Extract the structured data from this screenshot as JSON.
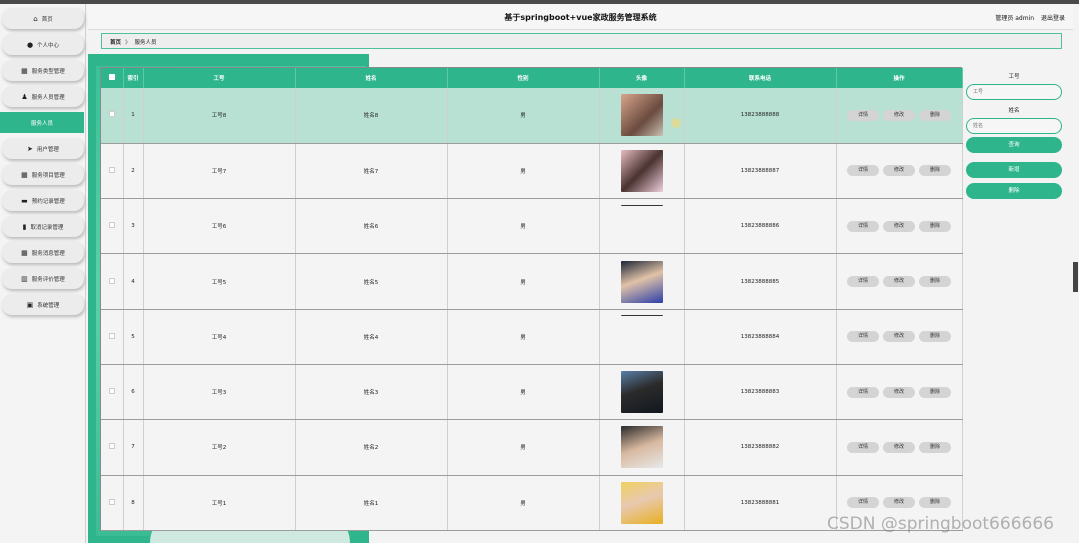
{
  "header": {
    "title": "基于springboot+vue家政服务管理系统",
    "user_label": "管理员 admin",
    "logout_label": "退出登录"
  },
  "sidebar": {
    "items": [
      {
        "label": "首页",
        "icon": "home-icon"
      },
      {
        "label": "个人中心",
        "icon": "user-icon"
      },
      {
        "label": "服务类型管理",
        "icon": "grid-icon"
      },
      {
        "label": "服务人员管理",
        "icon": "person-icon"
      },
      {
        "label": "服务人员",
        "icon": "",
        "active": true
      },
      {
        "label": "用户管理",
        "icon": "send-icon"
      },
      {
        "label": "服务项目管理",
        "icon": "grid-icon"
      },
      {
        "label": "预约记录管理",
        "icon": "ticket-icon"
      },
      {
        "label": "取消记录管理",
        "icon": "book-icon"
      },
      {
        "label": "服务消息管理",
        "icon": "grid-icon"
      },
      {
        "label": "服务评价管理",
        "icon": "bar-chart-icon"
      },
      {
        "label": "系统管理",
        "icon": "briefcase-icon"
      }
    ]
  },
  "breadcrumb": {
    "home": "首页",
    "separator": "》",
    "current": "服务人员"
  },
  "table": {
    "columns": [
      "索引",
      "工号",
      "姓名",
      "性别",
      "头像",
      "联系电话",
      "操作"
    ],
    "rows": [
      {
        "index": "1",
        "code": "工号8",
        "name": "姓名8",
        "gender": "男",
        "phone": "13823888888",
        "avatar": "photo",
        "highlight": true
      },
      {
        "index": "2",
        "code": "工号7",
        "name": "姓名7",
        "gender": "男",
        "phone": "13823888887",
        "avatar": "photo"
      },
      {
        "index": "3",
        "code": "工号6",
        "name": "姓名6",
        "gender": "男",
        "phone": "13823888886",
        "avatar": "broken"
      },
      {
        "index": "4",
        "code": "工号5",
        "name": "姓名5",
        "gender": "男",
        "phone": "13823888885",
        "avatar": "photo"
      },
      {
        "index": "5",
        "code": "工号4",
        "name": "姓名4",
        "gender": "男",
        "phone": "13823888884",
        "avatar": "broken"
      },
      {
        "index": "6",
        "code": "工号3",
        "name": "姓名3",
        "gender": "男",
        "phone": "13823888883",
        "avatar": "photo"
      },
      {
        "index": "7",
        "code": "工号2",
        "name": "姓名2",
        "gender": "男",
        "phone": "13823888882",
        "avatar": "photo"
      },
      {
        "index": "8",
        "code": "工号1",
        "name": "姓名1",
        "gender": "男",
        "phone": "13823888881",
        "avatar": "photo"
      }
    ],
    "actions": {
      "detail": "详情",
      "edit": "修改",
      "delete": "删除"
    }
  },
  "search": {
    "code_label": "工号",
    "code_placeholder": "工号",
    "name_label": "姓名",
    "name_placeholder": "姓名",
    "query_button": "查询",
    "add_button": "新增",
    "delete_button": "删除"
  },
  "watermark": "CSDN @springboot666666",
  "colors": {
    "accent": "#2fb58c",
    "highlight_row": "#b9e1d3"
  }
}
